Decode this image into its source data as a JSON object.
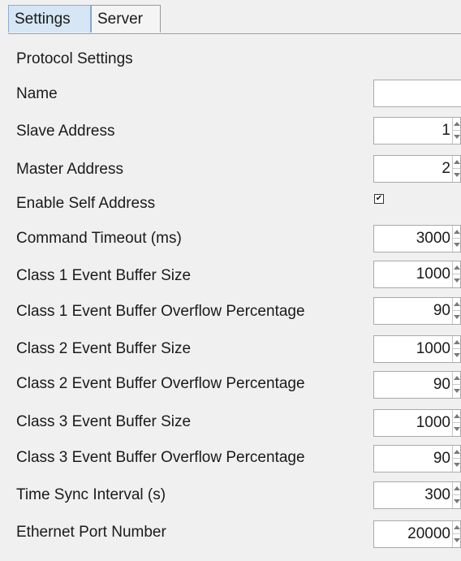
{
  "tabs": [
    {
      "label": "Settings",
      "active": true
    },
    {
      "label": "Server",
      "active": false
    }
  ],
  "section_title": "Protocol Settings",
  "fields": {
    "name": {
      "label": "Name",
      "value": ""
    },
    "slave_address": {
      "label": "Slave Address",
      "value": "1"
    },
    "master_address": {
      "label": "Master Address",
      "value": "2"
    },
    "enable_self_address": {
      "label": "Enable Self Address",
      "checked": true,
      "check_glyph": "✔"
    },
    "command_timeout": {
      "label": "Command Timeout (ms)",
      "value": "3000"
    },
    "class1_buffer_size": {
      "label": "Class 1 Event Buffer Size",
      "value": "1000"
    },
    "class1_overflow": {
      "label": "Class 1 Event Buffer Overflow Percentage",
      "value": "90"
    },
    "class2_buffer_size": {
      "label": "Class 2 Event Buffer Size",
      "value": "1000"
    },
    "class2_overflow": {
      "label": "Class 2 Event Buffer Overflow Percentage",
      "value": "90"
    },
    "class3_buffer_size": {
      "label": "Class 3 Event Buffer Size",
      "value": "1000"
    },
    "class3_overflow": {
      "label": "Class 3 Event Buffer Overflow Percentage",
      "value": "90"
    },
    "time_sync_interval": {
      "label": "Time Sync Interval (s)",
      "value": "300"
    },
    "ethernet_port": {
      "label": "Ethernet Port Number",
      "value": "20000"
    }
  },
  "colors": {
    "active_tab": "#d6e6f5",
    "background": "#f0f0f0",
    "field_bg": "#ffffff"
  }
}
